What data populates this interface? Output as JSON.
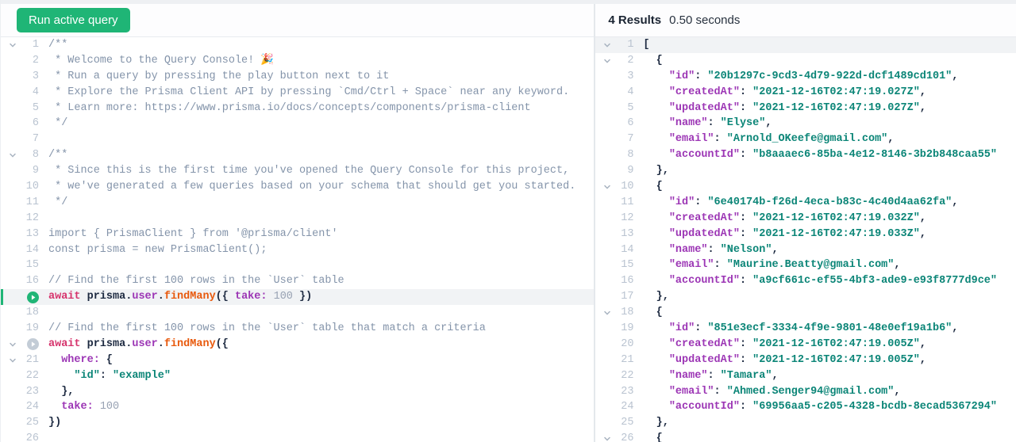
{
  "toolbar": {
    "run_button_label": "Run active query"
  },
  "results": {
    "count_label": "4 Results",
    "time_label": "0.50 seconds"
  },
  "colors": {
    "accent_green": "#1fb576",
    "keyword_red": "#d6336c",
    "property_purple": "#9c36b5",
    "function_orange": "#e8590c",
    "string_teal": "#0b8577",
    "comment_gray": "#8494aa",
    "number_gray": "#98a2b3",
    "line_number_gray": "#b9c3d0",
    "active_line_bg": "#f1f3f5"
  },
  "editor": {
    "lines": [
      {
        "n": 1,
        "chev": true,
        "toks": [
          [
            "cm",
            "/**"
          ]
        ]
      },
      {
        "n": 2,
        "toks": [
          [
            "cm",
            " * Welcome to the Query Console! "
          ],
          [
            "em",
            "🎉"
          ]
        ]
      },
      {
        "n": 3,
        "toks": [
          [
            "cm",
            " * Run a query by pressing the play button next to it"
          ]
        ]
      },
      {
        "n": 4,
        "toks": [
          [
            "cm",
            " * Explore the Prisma Client API by pressing `Cmd/Ctrl + Space` near any keyword."
          ]
        ]
      },
      {
        "n": 5,
        "toks": [
          [
            "cm",
            " * Learn more: https://www.prisma.io/docs/concepts/components/prisma-client"
          ]
        ]
      },
      {
        "n": 6,
        "toks": [
          [
            "cm",
            " */"
          ]
        ]
      },
      {
        "n": 7,
        "toks": []
      },
      {
        "n": 8,
        "chev": true,
        "toks": [
          [
            "cm",
            "/**"
          ]
        ]
      },
      {
        "n": 9,
        "toks": [
          [
            "cm",
            " * Since this is the first time you've opened the Query Console for this project,"
          ]
        ]
      },
      {
        "n": 10,
        "toks": [
          [
            "cm",
            " * we've generated a few queries based on your schema that should get you started."
          ]
        ]
      },
      {
        "n": 11,
        "toks": [
          [
            "cm",
            " */"
          ]
        ]
      },
      {
        "n": 12,
        "toks": []
      },
      {
        "n": 13,
        "toks": [
          [
            "cm",
            "import { PrismaClient } from '@prisma/client'"
          ]
        ]
      },
      {
        "n": 14,
        "toks": [
          [
            "cm",
            "const prisma = new PrismaClient();"
          ]
        ]
      },
      {
        "n": 15,
        "toks": []
      },
      {
        "n": 16,
        "toks": [
          [
            "cm",
            "// Find the first 100 rows in the `User` table"
          ]
        ]
      },
      {
        "n": 17,
        "play": "active",
        "hl": true,
        "bar": true,
        "toks": [
          [
            "kw",
            "await"
          ],
          [
            "pl",
            " prisma"
          ],
          [
            "pu",
            "."
          ],
          [
            "pr",
            "user"
          ],
          [
            "pu",
            "."
          ],
          [
            "fn",
            "findMany"
          ],
          [
            "pu",
            "({ "
          ],
          [
            "pr",
            "take:"
          ],
          [
            "nu",
            " 100"
          ],
          [
            "pu",
            " })"
          ]
        ]
      },
      {
        "n": 18,
        "toks": []
      },
      {
        "n": 19,
        "toks": [
          [
            "cm",
            "// Find the first 100 rows in the `User` table that match a criteria"
          ]
        ]
      },
      {
        "n": 20,
        "chev": true,
        "play": "inactive",
        "toks": [
          [
            "kw",
            "await"
          ],
          [
            "pl",
            " prisma"
          ],
          [
            "pu",
            "."
          ],
          [
            "pr",
            "user"
          ],
          [
            "pu",
            "."
          ],
          [
            "fn",
            "findMany"
          ],
          [
            "pu",
            "({"
          ]
        ]
      },
      {
        "n": 21,
        "chev": true,
        "toks": [
          [
            "pr",
            "  where:"
          ],
          [
            "pu",
            " {"
          ]
        ]
      },
      {
        "n": 22,
        "toks": [
          [
            "st",
            "    \"id\""
          ],
          [
            "pu",
            ": "
          ],
          [
            "st",
            "\"example\""
          ]
        ]
      },
      {
        "n": 23,
        "toks": [
          [
            "pu",
            "  },"
          ]
        ]
      },
      {
        "n": 24,
        "toks": [
          [
            "pr",
            "  take:"
          ],
          [
            "nu",
            " 100"
          ]
        ]
      },
      {
        "n": 25,
        "toks": [
          [
            "pu",
            "})"
          ]
        ]
      },
      {
        "n": 26,
        "toks": []
      }
    ]
  },
  "results_viewer": {
    "lines": [
      {
        "n": 1,
        "chev": true,
        "hl": true,
        "toks": [
          [
            "pu",
            "["
          ]
        ]
      },
      {
        "n": 2,
        "chev": true,
        "toks": [
          [
            "pu",
            "  {"
          ]
        ]
      },
      {
        "n": 3,
        "toks": [
          [
            "pr",
            "    \"id\""
          ],
          [
            "pu",
            ": "
          ],
          [
            "st",
            "\"20b1297c-9cd3-4d79-922d-dcf1489cd101\""
          ],
          [
            "pu",
            ","
          ]
        ]
      },
      {
        "n": 4,
        "toks": [
          [
            "pr",
            "    \"createdAt\""
          ],
          [
            "pu",
            ": "
          ],
          [
            "st",
            "\"2021-12-16T02:47:19.027Z\""
          ],
          [
            "pu",
            ","
          ]
        ]
      },
      {
        "n": 5,
        "toks": [
          [
            "pr",
            "    \"updatedAt\""
          ],
          [
            "pu",
            ": "
          ],
          [
            "st",
            "\"2021-12-16T02:47:19.027Z\""
          ],
          [
            "pu",
            ","
          ]
        ]
      },
      {
        "n": 6,
        "toks": [
          [
            "pr",
            "    \"name\""
          ],
          [
            "pu",
            ": "
          ],
          [
            "st",
            "\"Elyse\""
          ],
          [
            "pu",
            ","
          ]
        ]
      },
      {
        "n": 7,
        "toks": [
          [
            "pr",
            "    \"email\""
          ],
          [
            "pu",
            ": "
          ],
          [
            "st",
            "\"Arnold_OKeefe@gmail.com\""
          ],
          [
            "pu",
            ","
          ]
        ]
      },
      {
        "n": 8,
        "toks": [
          [
            "pr",
            "    \"accountId\""
          ],
          [
            "pu",
            ": "
          ],
          [
            "st",
            "\"b8aaaec6-85ba-4e12-8146-3b2b848caa55\""
          ]
        ]
      },
      {
        "n": 9,
        "toks": [
          [
            "pu",
            "  },"
          ]
        ]
      },
      {
        "n": 10,
        "chev": true,
        "toks": [
          [
            "pu",
            "  {"
          ]
        ]
      },
      {
        "n": 11,
        "toks": [
          [
            "pr",
            "    \"id\""
          ],
          [
            "pu",
            ": "
          ],
          [
            "st",
            "\"6e40174b-f26d-4eca-b83c-4c40d4aa62fa\""
          ],
          [
            "pu",
            ","
          ]
        ]
      },
      {
        "n": 12,
        "toks": [
          [
            "pr",
            "    \"createdAt\""
          ],
          [
            "pu",
            ": "
          ],
          [
            "st",
            "\"2021-12-16T02:47:19.032Z\""
          ],
          [
            "pu",
            ","
          ]
        ]
      },
      {
        "n": 13,
        "toks": [
          [
            "pr",
            "    \"updatedAt\""
          ],
          [
            "pu",
            ": "
          ],
          [
            "st",
            "\"2021-12-16T02:47:19.033Z\""
          ],
          [
            "pu",
            ","
          ]
        ]
      },
      {
        "n": 14,
        "toks": [
          [
            "pr",
            "    \"name\""
          ],
          [
            "pu",
            ": "
          ],
          [
            "st",
            "\"Nelson\""
          ],
          [
            "pu",
            ","
          ]
        ]
      },
      {
        "n": 15,
        "toks": [
          [
            "pr",
            "    \"email\""
          ],
          [
            "pu",
            ": "
          ],
          [
            "st",
            "\"Maurine.Beatty@gmail.com\""
          ],
          [
            "pu",
            ","
          ]
        ]
      },
      {
        "n": 16,
        "toks": [
          [
            "pr",
            "    \"accountId\""
          ],
          [
            "pu",
            ": "
          ],
          [
            "st",
            "\"a9cf661c-ef55-4bf3-ade9-e93f8777d9ce\""
          ]
        ]
      },
      {
        "n": 17,
        "toks": [
          [
            "pu",
            "  },"
          ]
        ]
      },
      {
        "n": 18,
        "chev": true,
        "toks": [
          [
            "pu",
            "  {"
          ]
        ]
      },
      {
        "n": 19,
        "toks": [
          [
            "pr",
            "    \"id\""
          ],
          [
            "pu",
            ": "
          ],
          [
            "st",
            "\"851e3ecf-3334-4f9e-9801-48e0ef19a1b6\""
          ],
          [
            "pu",
            ","
          ]
        ]
      },
      {
        "n": 20,
        "toks": [
          [
            "pr",
            "    \"createdAt\""
          ],
          [
            "pu",
            ": "
          ],
          [
            "st",
            "\"2021-12-16T02:47:19.005Z\""
          ],
          [
            "pu",
            ","
          ]
        ]
      },
      {
        "n": 21,
        "toks": [
          [
            "pr",
            "    \"updatedAt\""
          ],
          [
            "pu",
            ": "
          ],
          [
            "st",
            "\"2021-12-16T02:47:19.005Z\""
          ],
          [
            "pu",
            ","
          ]
        ]
      },
      {
        "n": 22,
        "toks": [
          [
            "pr",
            "    \"name\""
          ],
          [
            "pu",
            ": "
          ],
          [
            "st",
            "\"Tamara\""
          ],
          [
            "pu",
            ","
          ]
        ]
      },
      {
        "n": 23,
        "toks": [
          [
            "pr",
            "    \"email\""
          ],
          [
            "pu",
            ": "
          ],
          [
            "st",
            "\"Ahmed.Senger94@gmail.com\""
          ],
          [
            "pu",
            ","
          ]
        ]
      },
      {
        "n": 24,
        "toks": [
          [
            "pr",
            "    \"accountId\""
          ],
          [
            "pu",
            ": "
          ],
          [
            "st",
            "\"69956aa5-c205-4328-bcdb-8ecad5367294\""
          ]
        ]
      },
      {
        "n": 25,
        "toks": [
          [
            "pu",
            "  },"
          ]
        ]
      },
      {
        "n": 26,
        "chev": true,
        "toks": [
          [
            "pu",
            "  {"
          ]
        ]
      }
    ]
  }
}
